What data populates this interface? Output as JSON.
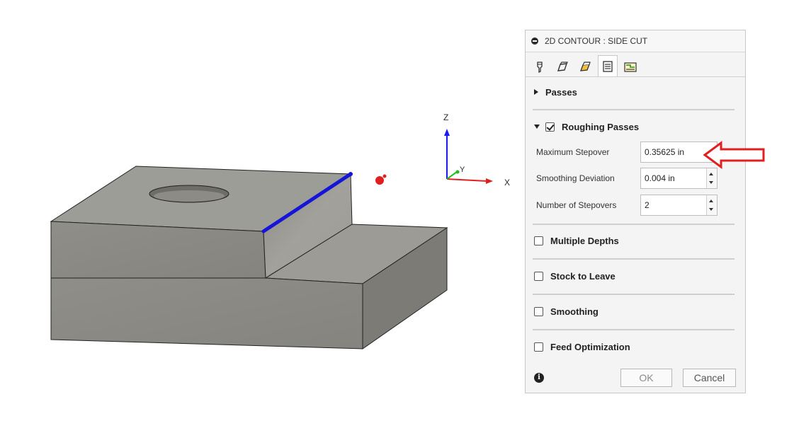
{
  "dialog": {
    "title": "2D CONTOUR : SIDE CUT",
    "tabs": [
      {
        "icon": "tool-icon",
        "active": false
      },
      {
        "icon": "geometry-icon",
        "active": false
      },
      {
        "icon": "heights-icon",
        "active": false
      },
      {
        "icon": "passes-icon",
        "active": true
      },
      {
        "icon": "linking-icon",
        "active": false
      }
    ],
    "sections": {
      "passes": {
        "label": "Passes",
        "expanded": false
      },
      "roughing": {
        "label": "Roughing Passes",
        "checked": true,
        "expanded": true
      },
      "multiple_depths": {
        "label": "Multiple Depths",
        "checked": false
      },
      "stock_to_leave": {
        "label": "Stock to Leave",
        "checked": false
      },
      "smoothing": {
        "label": "Smoothing",
        "checked": false
      },
      "feed_optimization": {
        "label": "Feed Optimization",
        "checked": false
      }
    },
    "fields": [
      {
        "label": "Maximum Stepover",
        "value": "0.35625 in"
      },
      {
        "label": "Smoothing Deviation",
        "value": "0.004 in"
      },
      {
        "label": "Number of Stepovers",
        "value": "2"
      }
    ],
    "buttons": {
      "ok": "OK",
      "cancel": "Cancel"
    },
    "info_icon": "i"
  },
  "viewport": {
    "axis_labels": {
      "x": "X",
      "y": "Y",
      "z": "Z"
    },
    "colors": {
      "model_top": "#9d9d98",
      "model_front": "#8e8d87",
      "model_side": "#787772",
      "selected_edge": "#1515d8",
      "axis_x": "#e02020",
      "axis_y": "#22bb22",
      "axis_z": "#1a1aee"
    }
  },
  "annotation": {
    "color": "#e02020"
  }
}
